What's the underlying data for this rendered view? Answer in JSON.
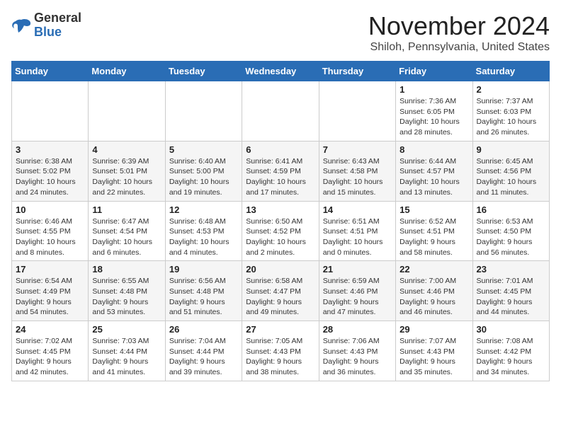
{
  "header": {
    "logo_line1": "General",
    "logo_line2": "Blue",
    "month_title": "November 2024",
    "location": "Shiloh, Pennsylvania, United States"
  },
  "weekdays": [
    "Sunday",
    "Monday",
    "Tuesday",
    "Wednesday",
    "Thursday",
    "Friday",
    "Saturday"
  ],
  "weeks": [
    [
      {
        "day": "",
        "info": ""
      },
      {
        "day": "",
        "info": ""
      },
      {
        "day": "",
        "info": ""
      },
      {
        "day": "",
        "info": ""
      },
      {
        "day": "",
        "info": ""
      },
      {
        "day": "1",
        "info": "Sunrise: 7:36 AM\nSunset: 6:05 PM\nDaylight: 10 hours and 28 minutes."
      },
      {
        "day": "2",
        "info": "Sunrise: 7:37 AM\nSunset: 6:03 PM\nDaylight: 10 hours and 26 minutes."
      }
    ],
    [
      {
        "day": "3",
        "info": "Sunrise: 6:38 AM\nSunset: 5:02 PM\nDaylight: 10 hours and 24 minutes."
      },
      {
        "day": "4",
        "info": "Sunrise: 6:39 AM\nSunset: 5:01 PM\nDaylight: 10 hours and 22 minutes."
      },
      {
        "day": "5",
        "info": "Sunrise: 6:40 AM\nSunset: 5:00 PM\nDaylight: 10 hours and 19 minutes."
      },
      {
        "day": "6",
        "info": "Sunrise: 6:41 AM\nSunset: 4:59 PM\nDaylight: 10 hours and 17 minutes."
      },
      {
        "day": "7",
        "info": "Sunrise: 6:43 AM\nSunset: 4:58 PM\nDaylight: 10 hours and 15 minutes."
      },
      {
        "day": "8",
        "info": "Sunrise: 6:44 AM\nSunset: 4:57 PM\nDaylight: 10 hours and 13 minutes."
      },
      {
        "day": "9",
        "info": "Sunrise: 6:45 AM\nSunset: 4:56 PM\nDaylight: 10 hours and 11 minutes."
      }
    ],
    [
      {
        "day": "10",
        "info": "Sunrise: 6:46 AM\nSunset: 4:55 PM\nDaylight: 10 hours and 8 minutes."
      },
      {
        "day": "11",
        "info": "Sunrise: 6:47 AM\nSunset: 4:54 PM\nDaylight: 10 hours and 6 minutes."
      },
      {
        "day": "12",
        "info": "Sunrise: 6:48 AM\nSunset: 4:53 PM\nDaylight: 10 hours and 4 minutes."
      },
      {
        "day": "13",
        "info": "Sunrise: 6:50 AM\nSunset: 4:52 PM\nDaylight: 10 hours and 2 minutes."
      },
      {
        "day": "14",
        "info": "Sunrise: 6:51 AM\nSunset: 4:51 PM\nDaylight: 10 hours and 0 minutes."
      },
      {
        "day": "15",
        "info": "Sunrise: 6:52 AM\nSunset: 4:51 PM\nDaylight: 9 hours and 58 minutes."
      },
      {
        "day": "16",
        "info": "Sunrise: 6:53 AM\nSunset: 4:50 PM\nDaylight: 9 hours and 56 minutes."
      }
    ],
    [
      {
        "day": "17",
        "info": "Sunrise: 6:54 AM\nSunset: 4:49 PM\nDaylight: 9 hours and 54 minutes."
      },
      {
        "day": "18",
        "info": "Sunrise: 6:55 AM\nSunset: 4:48 PM\nDaylight: 9 hours and 53 minutes."
      },
      {
        "day": "19",
        "info": "Sunrise: 6:56 AM\nSunset: 4:48 PM\nDaylight: 9 hours and 51 minutes."
      },
      {
        "day": "20",
        "info": "Sunrise: 6:58 AM\nSunset: 4:47 PM\nDaylight: 9 hours and 49 minutes."
      },
      {
        "day": "21",
        "info": "Sunrise: 6:59 AM\nSunset: 4:46 PM\nDaylight: 9 hours and 47 minutes."
      },
      {
        "day": "22",
        "info": "Sunrise: 7:00 AM\nSunset: 4:46 PM\nDaylight: 9 hours and 46 minutes."
      },
      {
        "day": "23",
        "info": "Sunrise: 7:01 AM\nSunset: 4:45 PM\nDaylight: 9 hours and 44 minutes."
      }
    ],
    [
      {
        "day": "24",
        "info": "Sunrise: 7:02 AM\nSunset: 4:45 PM\nDaylight: 9 hours and 42 minutes."
      },
      {
        "day": "25",
        "info": "Sunrise: 7:03 AM\nSunset: 4:44 PM\nDaylight: 9 hours and 41 minutes."
      },
      {
        "day": "26",
        "info": "Sunrise: 7:04 AM\nSunset: 4:44 PM\nDaylight: 9 hours and 39 minutes."
      },
      {
        "day": "27",
        "info": "Sunrise: 7:05 AM\nSunset: 4:43 PM\nDaylight: 9 hours and 38 minutes."
      },
      {
        "day": "28",
        "info": "Sunrise: 7:06 AM\nSunset: 4:43 PM\nDaylight: 9 hours and 36 minutes."
      },
      {
        "day": "29",
        "info": "Sunrise: 7:07 AM\nSunset: 4:43 PM\nDaylight: 9 hours and 35 minutes."
      },
      {
        "day": "30",
        "info": "Sunrise: 7:08 AM\nSunset: 4:42 PM\nDaylight: 9 hours and 34 minutes."
      }
    ]
  ]
}
